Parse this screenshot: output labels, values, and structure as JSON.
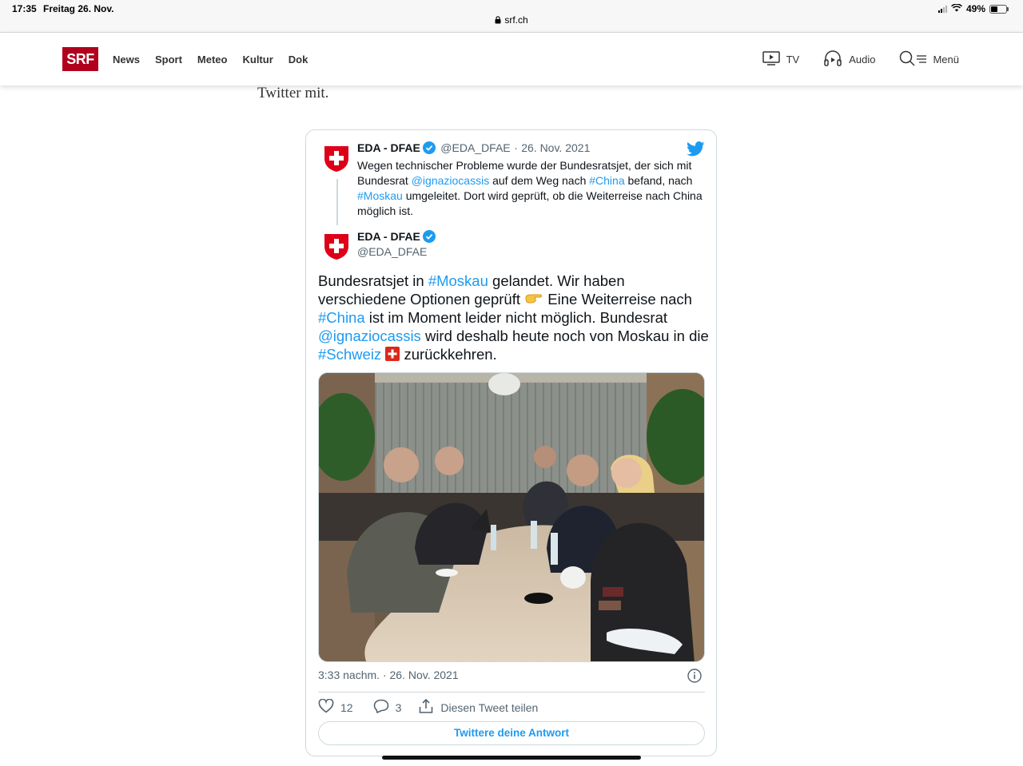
{
  "status_bar": {
    "time": "17:35",
    "date": "Freitag 26. Nov.",
    "url": "srf.ch",
    "battery": "49%",
    "battery_level": 0.49
  },
  "header": {
    "logo": "SRF",
    "nav": [
      "News",
      "Sport",
      "Meteo",
      "Kultur",
      "Dok"
    ],
    "tv_label": "TV",
    "audio_label": "Audio",
    "menu_label": "Menü"
  },
  "article": {
    "text_fragment": "Twitter mit."
  },
  "tweet": {
    "quoted": {
      "name": "EDA - DFAE",
      "handle": "@EDA_DFAE",
      "separator": "·",
      "date": "26. Nov. 2021",
      "text": [
        {
          "t": "Wegen technischer Probleme wurde der Bundesratsjet, der sich mit Bundesrat "
        },
        {
          "t": "@ignaziocassis",
          "link": true
        },
        {
          "t": " auf dem Weg nach "
        },
        {
          "t": "#China",
          "link": true
        },
        {
          "t": " befand, nach "
        },
        {
          "t": "#Moskau",
          "link": true
        },
        {
          "t": " umgeleitet. Dort wird geprüft, ob die Weiterreise nach China möglich ist."
        }
      ]
    },
    "author": {
      "name": "EDA - DFAE",
      "handle": "@EDA_DFAE"
    },
    "text": [
      {
        "t": "Bundesratsjet in "
      },
      {
        "t": "#Moskau",
        "link": true
      },
      {
        "t": " gelandet. Wir haben verschiedene Optionen geprüft "
      },
      {
        "emoji": "pointing-hand"
      },
      {
        "t": " Eine Weiterreise nach "
      },
      {
        "t": "#China",
        "link": true
      },
      {
        "t": " ist im Moment leider nicht möglich. Bundesrat "
      },
      {
        "t": "@ignaziocassis",
        "link": true
      },
      {
        "t": " wird deshalb heute noch von Moskau in die "
      },
      {
        "t": "#Schweiz",
        "link": true
      },
      {
        "t": " "
      },
      {
        "emoji": "swiss-flag"
      },
      {
        "t": " zurückkehren."
      }
    ],
    "timestamp": "3:33 nachm. · 26. Nov. 2021",
    "likes": "12",
    "replies": "3",
    "share_label": "Diesen Tweet teilen",
    "reply_button": "Twittere deine Antwort"
  },
  "colors": {
    "srf_red": "#af001d",
    "twitter_blue": "#1d9bf0",
    "verified_blue": "#1d9bf0"
  }
}
